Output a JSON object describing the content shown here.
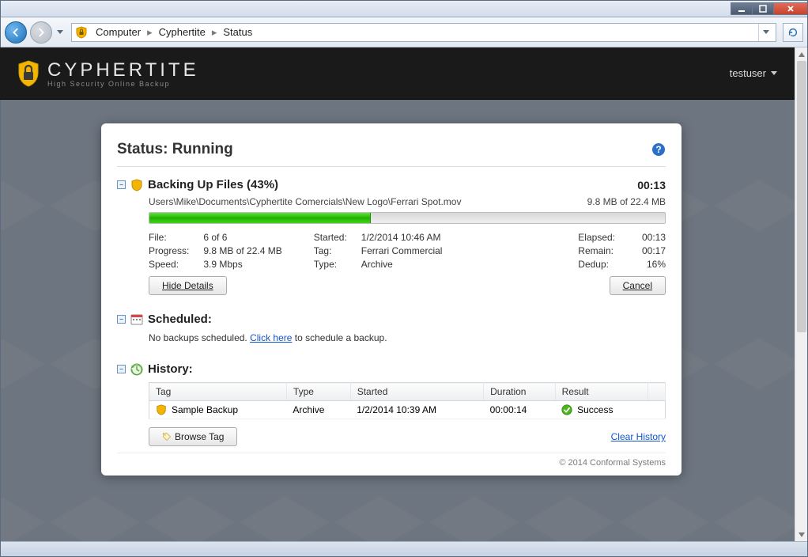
{
  "breadcrumb": {
    "root": "Computer",
    "mid": "Cyphertite",
    "leaf": "Status"
  },
  "brand": {
    "name": "CYPHERTITE",
    "tagline": "High Security Online Backup",
    "user": "testuser"
  },
  "title_prefix": "Status:",
  "title_state": "Running",
  "backup": {
    "heading": "Backing Up Files (43%)",
    "timer": "00:13",
    "path": "Users\\Mike\\Documents\\Cyphertite Comercials\\New Logo\\Ferrari Spot.mov",
    "progress_text": "9.8 MB of 22.4 MB",
    "labels": {
      "file": "File:",
      "progress": "Progress:",
      "speed": "Speed:",
      "started": "Started:",
      "tag": "Tag:",
      "type": "Type:",
      "elapsed": "Elapsed:",
      "remain": "Remain:",
      "dedup": "Dedup:"
    },
    "values": {
      "file": "6 of 6",
      "progress": "9.8 MB of 22.4 MB",
      "speed": "3.9 Mbps",
      "started": "1/2/2014 10:46 AM",
      "tag": "Ferrari Commercial",
      "type": "Archive",
      "elapsed": "00:13",
      "remain": "00:17",
      "dedup": "16%"
    },
    "hide_details_label": "Hide Details",
    "cancel_label": "Cancel"
  },
  "scheduled": {
    "heading": "Scheduled:",
    "text_pre": "No backups scheduled. ",
    "link": "Click here",
    "text_post": " to schedule a backup."
  },
  "history": {
    "heading": "History:",
    "cols": {
      "tag": "Tag",
      "type": "Type",
      "started": "Started",
      "duration": "Duration",
      "result": "Result"
    },
    "rows": [
      {
        "tag": "Sample Backup",
        "type": "Archive",
        "started": "1/2/2014 10:39 AM",
        "duration": "00:00:14",
        "result": "Success"
      }
    ],
    "browse_label": "Browse Tag",
    "clear_label": "Clear History"
  },
  "footer": "© 2014 Conformal Systems"
}
